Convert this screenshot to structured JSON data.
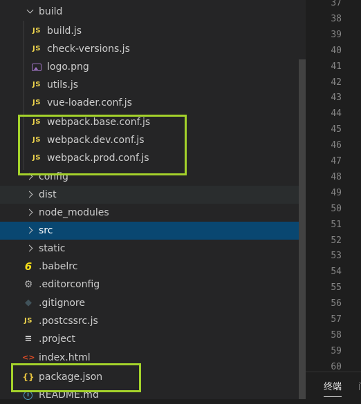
{
  "explorer": {
    "build_folder": "build",
    "build_files": [
      {
        "label": "build.js",
        "icon": "js"
      },
      {
        "label": "check-versions.js",
        "icon": "js"
      },
      {
        "label": "logo.png",
        "icon": "image"
      },
      {
        "label": "utils.js",
        "icon": "js"
      },
      {
        "label": "vue-loader.conf.js",
        "icon": "js"
      },
      {
        "label": "webpack.base.conf.js",
        "icon": "js"
      },
      {
        "label": "webpack.dev.conf.js",
        "icon": "js"
      },
      {
        "label": "webpack.prod.conf.js",
        "icon": "js"
      }
    ],
    "folders": [
      {
        "label": "config"
      },
      {
        "label": "dist"
      },
      {
        "label": "node_modules"
      },
      {
        "label": "src"
      },
      {
        "label": "static"
      }
    ],
    "root_files": [
      {
        "label": ".babelrc",
        "icon": "babel"
      },
      {
        "label": ".editorconfig",
        "icon": "gear"
      },
      {
        "label": ".gitignore",
        "icon": "git"
      },
      {
        "label": ".postcssrc.js",
        "icon": "js"
      },
      {
        "label": ".project",
        "icon": "lines"
      },
      {
        "label": "index.html",
        "icon": "html"
      },
      {
        "label": "package.json",
        "icon": "json"
      },
      {
        "label": "README.md",
        "icon": "info"
      }
    ],
    "icon_glyphs": {
      "js": "JS",
      "babel": "6",
      "gear": "⚙",
      "git": "◆",
      "lines": "≡",
      "html": "<>",
      "json": "{}",
      "info": "i"
    },
    "highlight_color": "#a4d22b",
    "selected_color": "#094771"
  },
  "editor": {
    "line_numbers": [
      "37",
      "38",
      "39",
      "40",
      "41",
      "42",
      "43",
      "44",
      "45",
      "46",
      "47",
      "48",
      "49",
      "50",
      "51",
      "52",
      "53",
      "54",
      "55",
      "56",
      "57",
      "58",
      "59",
      "60"
    ]
  },
  "panel": {
    "terminal_tab": "终端",
    "next_tab_partial": "问"
  }
}
